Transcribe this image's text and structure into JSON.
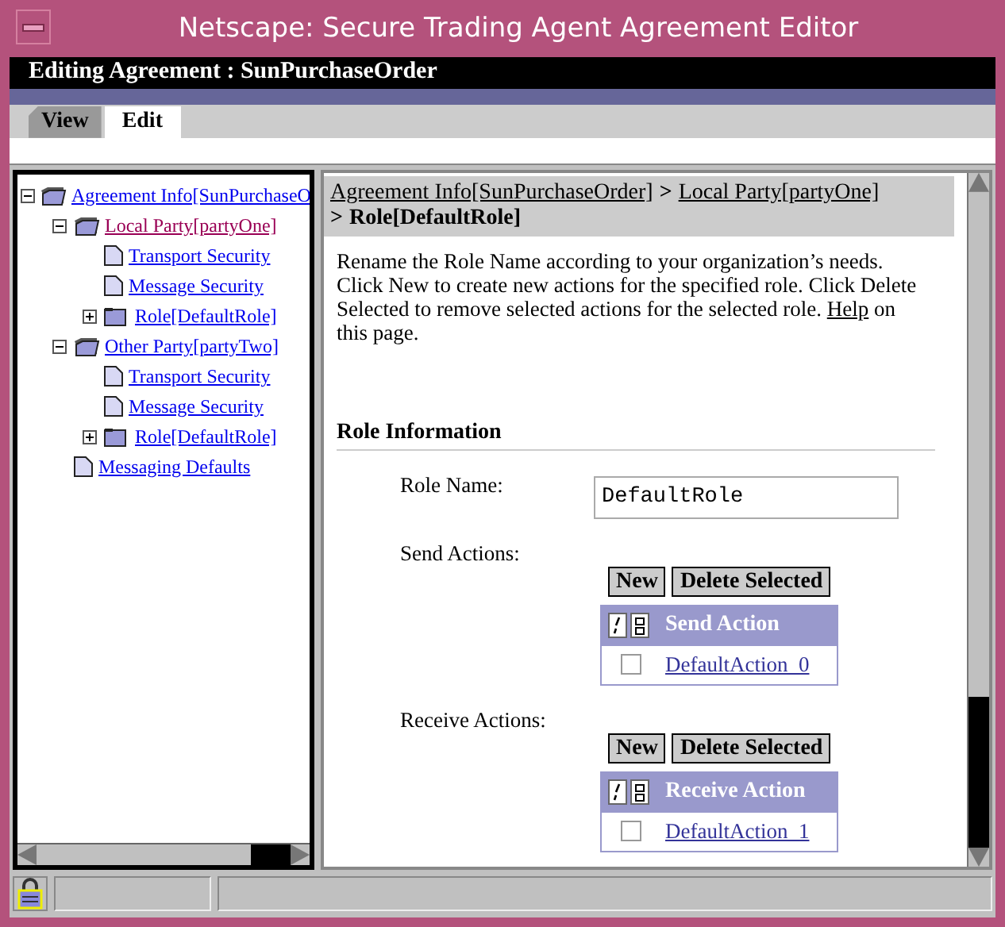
{
  "window": {
    "title": "Netscape: Secure Trading Agent Agreement Editor"
  },
  "header": {
    "title": "Editing Agreement : SunPurchaseOrder"
  },
  "tabs": [
    {
      "label": "View",
      "selected": false
    },
    {
      "label": "Edit",
      "selected": true
    }
  ],
  "tree": [
    {
      "label": "Agreement Info[SunPurchaseO",
      "kind": "folder",
      "expanded": true,
      "selected": false,
      "children": [
        {
          "label": "Local Party[partyOne]",
          "kind": "folder",
          "expanded": true,
          "selected": true,
          "children": [
            {
              "label": "Transport Security",
              "kind": "page",
              "selected": false
            },
            {
              "label": "Message Security",
              "kind": "page",
              "selected": false
            },
            {
              "label": "Role[DefaultRole]",
              "kind": "folder",
              "expanded": false,
              "selected": false
            }
          ]
        },
        {
          "label": "Other Party[partyTwo]",
          "kind": "folder",
          "expanded": true,
          "selected": false,
          "children": [
            {
              "label": "Transport Security",
              "kind": "page",
              "selected": false
            },
            {
              "label": "Message Security",
              "kind": "page",
              "selected": false
            },
            {
              "label": "Role[DefaultRole]",
              "kind": "folder",
              "expanded": false,
              "selected": false
            }
          ]
        },
        {
          "label": "Messaging Defaults",
          "kind": "page",
          "selected": false
        }
      ]
    }
  ],
  "breadcrumb": {
    "links": [
      "Agreement Info[SunPurchaseOrder]",
      "Local Party[partyOne]"
    ],
    "separator": ">",
    "current": "Role[DefaultRole]"
  },
  "description": {
    "text": "Rename the Role Name according to your organization’s needs. Click New to create new actions for the specified role. Click Delete Selected to remove selected actions for the selected role.",
    "link": "Help",
    "after": "on this page."
  },
  "section": {
    "title": "Role Information"
  },
  "role_name": {
    "label": "Role Name:",
    "value": "DefaultRole"
  },
  "action_groups": [
    {
      "label": "Send Actions:",
      "buttons": [
        "New",
        "Delete Selected"
      ],
      "column": "Send Action",
      "rows": [
        {
          "checked": false,
          "name": "DefaultAction_0"
        }
      ]
    },
    {
      "label": "Receive Actions:",
      "buttons": [
        "New",
        "Delete Selected"
      ],
      "column": "Receive Action",
      "rows": [
        {
          "checked": false,
          "name": "DefaultAction_1"
        }
      ]
    }
  ]
}
